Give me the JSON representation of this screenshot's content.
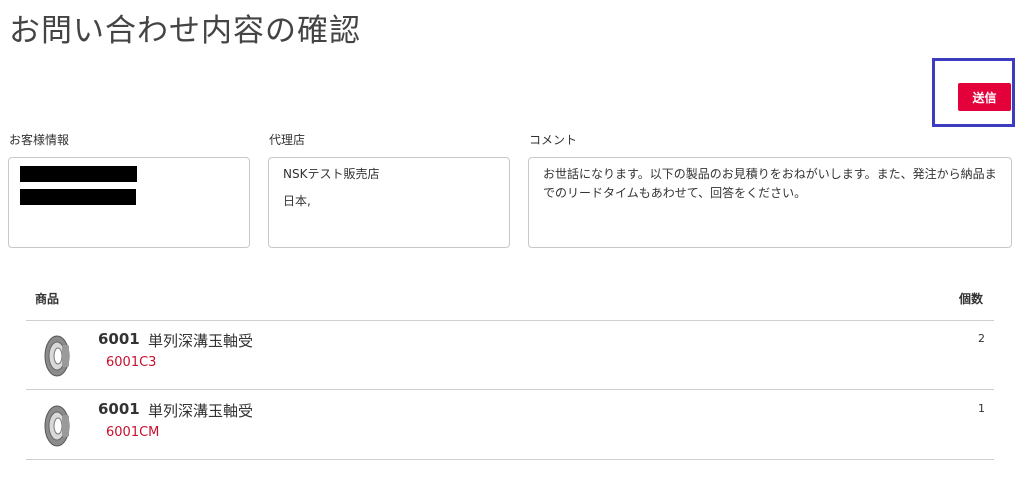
{
  "page": {
    "title": "お問い合わせ内容の確認"
  },
  "toolbar": {
    "submit_label": "送信",
    "accent_color": "#e4003b",
    "highlight_color": "#3d3bbf"
  },
  "sections": {
    "customer": {
      "label": "お客様情報"
    },
    "agent": {
      "label": "代理店",
      "lines": [
        "NSKテスト販売店",
        "日本,"
      ]
    },
    "comment": {
      "label": "コメント",
      "text": "お世話になります。以下の製品のお見積りをおねがいします。また、発注から納品までのリードタイムもあわせて、回答をください。"
    }
  },
  "table": {
    "headers": {
      "product": "商品",
      "quantity": "個数"
    },
    "rows": [
      {
        "icon": "bearing-icon",
        "code": "6001",
        "name": "単列深溝玉軸受",
        "variant": "6001C3",
        "quantity": "2"
      },
      {
        "icon": "bearing-icon",
        "code": "6001",
        "name": "単列深溝玉軸受",
        "variant": "6001CM",
        "quantity": "1"
      }
    ]
  }
}
